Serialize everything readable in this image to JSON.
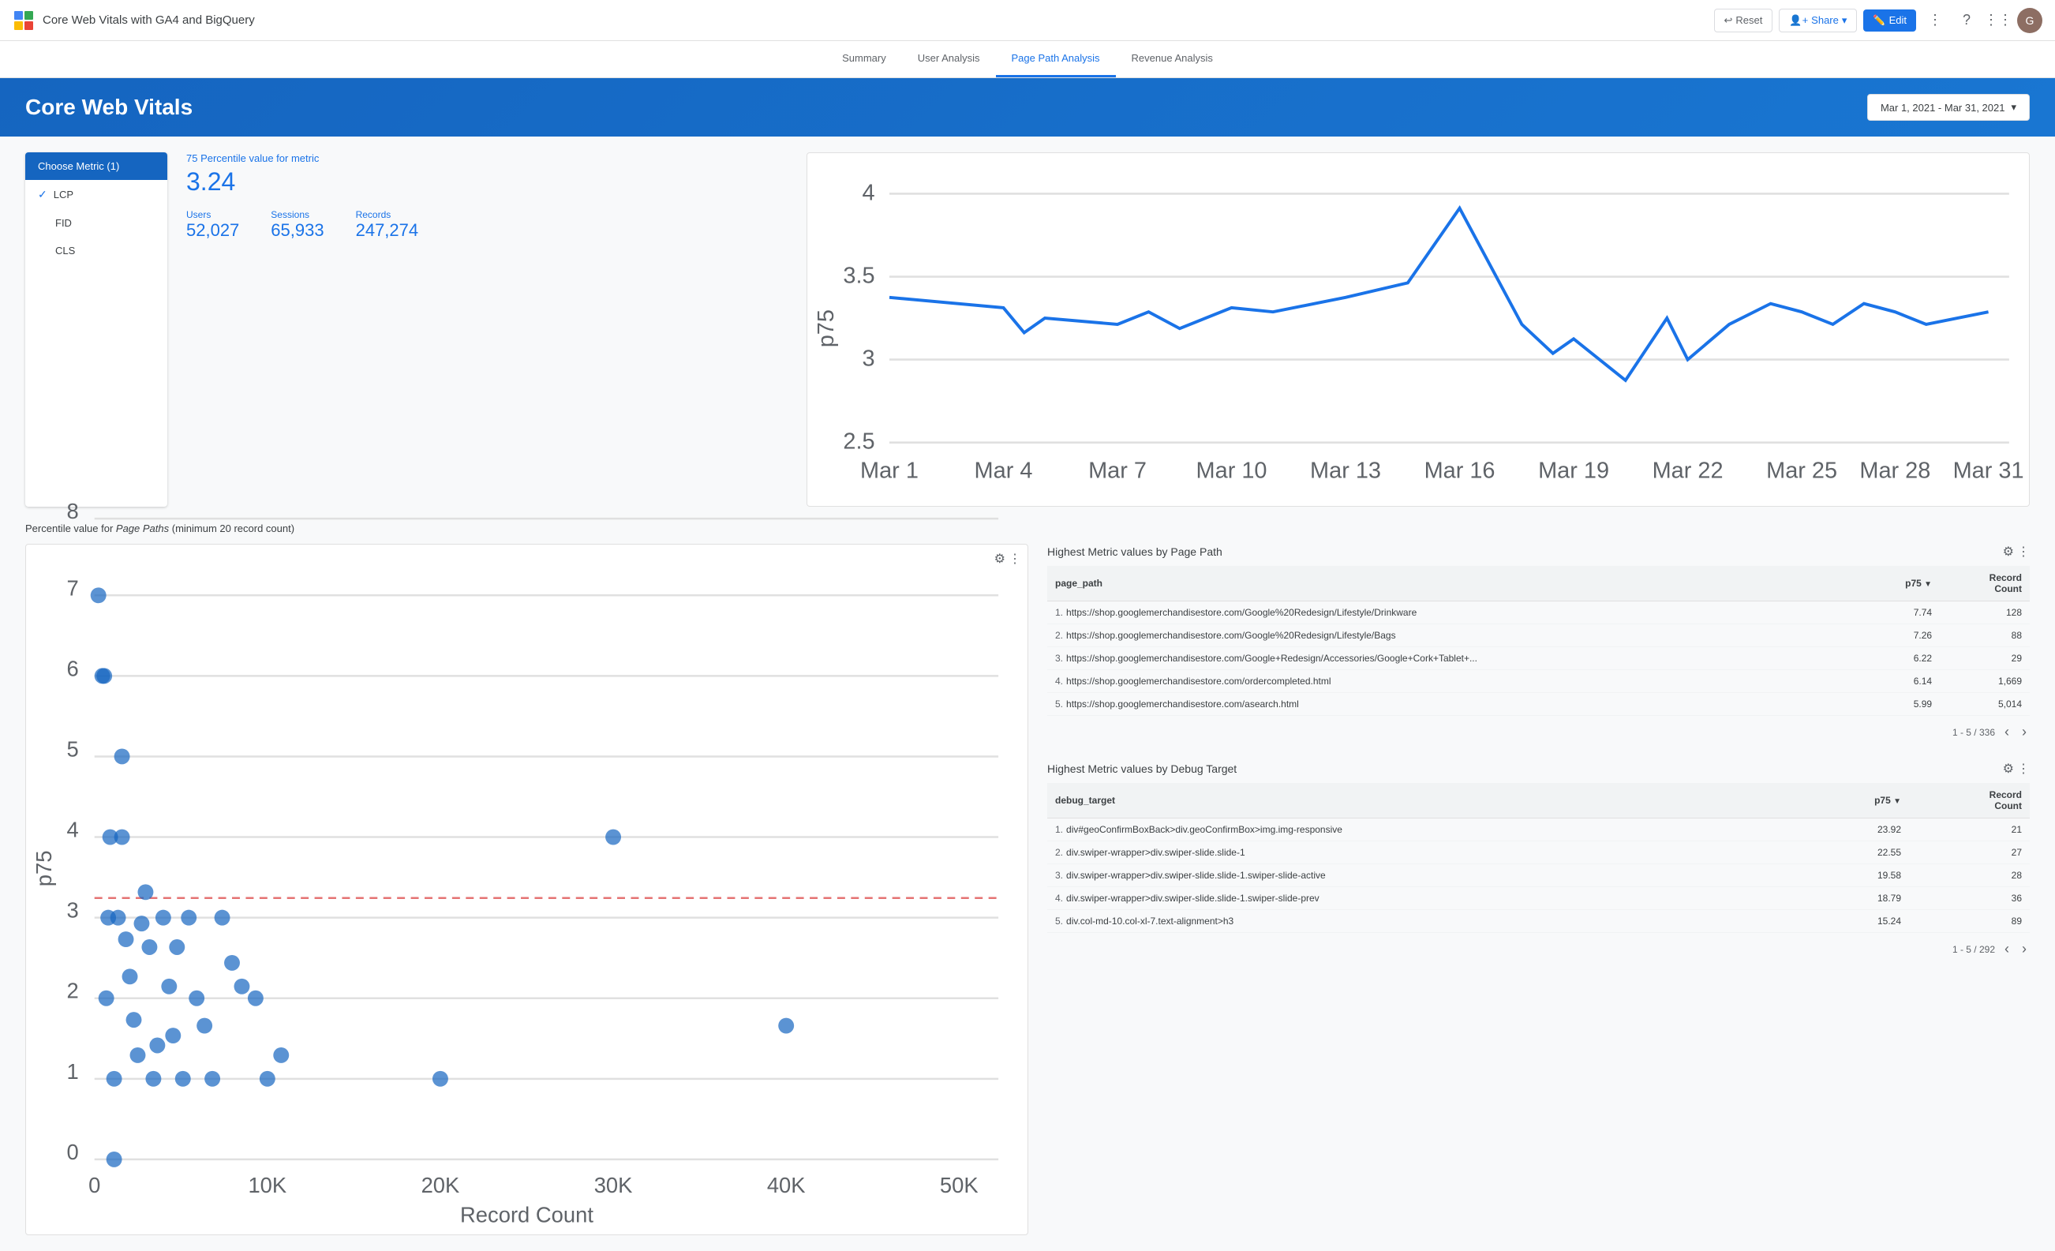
{
  "app": {
    "title": "Core Web Vitals with GA4 and BigQuery",
    "logo": "chart-icon"
  },
  "toolbar": {
    "reset_label": "Reset",
    "share_label": "Share",
    "edit_label": "Edit"
  },
  "nav": {
    "tabs": [
      {
        "label": "Summary",
        "active": false
      },
      {
        "label": "User Analysis",
        "active": false
      },
      {
        "label": "Page Path Analysis",
        "active": true
      },
      {
        "label": "Revenue Analysis",
        "active": false
      }
    ]
  },
  "banner": {
    "title": "Core Web Vitals",
    "date_range": "Mar 1, 2021 - Mar 31, 2021"
  },
  "metric_selector": {
    "header": "Choose Metric (1)",
    "options": [
      {
        "label": "LCP",
        "selected": true
      },
      {
        "label": "FID",
        "selected": false
      },
      {
        "label": "CLS",
        "selected": false
      }
    ]
  },
  "metric_stats": {
    "percentile_label": "75 Percentile value for metric",
    "percentile_value": "3.24",
    "users_label": "Users",
    "users_value": "52,027",
    "sessions_label": "Sessions",
    "sessions_value": "65,933",
    "records_label": "Records",
    "records_value": "247,274"
  },
  "line_chart": {
    "x_labels": [
      "Mar 1",
      "Mar 4",
      "Mar 7",
      "Mar 10",
      "Mar 13",
      "Mar 16",
      "Mar 19",
      "Mar 22",
      "Mar 25",
      "Mar 28",
      "Mar 31"
    ],
    "y_labels": [
      "2.5",
      "3",
      "3.5",
      "4"
    ],
    "y_axis_label": "p75"
  },
  "scatter_chart": {
    "x_axis_label": "Record Count",
    "y_axis_label": "p75",
    "x_labels": [
      "0",
      "10K",
      "20K",
      "30K",
      "40K",
      "50K"
    ],
    "y_labels": [
      "0",
      "1",
      "2",
      "3",
      "4",
      "5",
      "6",
      "7",
      "8"
    ]
  },
  "section_label": "Percentile value for Page Paths (minimum 20 record count)",
  "page_paths_table": {
    "title": "Highest Metric values by Page Path",
    "columns": [
      "page_path",
      "p75",
      "Record Count"
    ],
    "rows": [
      {
        "num": "1.",
        "path": "https://shop.googlemerchandisestore.com/Google%20Redesign/Lifestyle/Drinkware",
        "p75": "7.74",
        "count": "128"
      },
      {
        "num": "2.",
        "path": "https://shop.googlemerchandisestore.com/Google%20Redesign/Lifestyle/Bags",
        "p75": "7.26",
        "count": "88"
      },
      {
        "num": "3.",
        "path": "https://shop.googlemerchandisestore.com/Google+Redesign/Accessories/Google+Cork+Tablet+...",
        "p75": "6.22",
        "count": "29"
      },
      {
        "num": "4.",
        "path": "https://shop.googlemerchandisestore.com/ordercompleted.html",
        "p75": "6.14",
        "count": "1,669"
      },
      {
        "num": "5.",
        "path": "https://shop.googlemerchandisestore.com/asearch.html",
        "p75": "5.99",
        "count": "5,014"
      }
    ],
    "pagination": "1 - 5 / 336"
  },
  "debug_table": {
    "title": "Highest Metric values by Debug Target",
    "columns": [
      "debug_target",
      "p75",
      "Record Count"
    ],
    "rows": [
      {
        "num": "1.",
        "target": "div#geoConfirmBoxBack>div.geoConfirmBox>img.img-responsive",
        "p75": "23.92",
        "count": "21"
      },
      {
        "num": "2.",
        "target": "div.swiper-wrapper>div.swiper-slide.slide-1",
        "p75": "22.55",
        "count": "27"
      },
      {
        "num": "3.",
        "target": "div.swiper-wrapper>div.swiper-slide.slide-1.swiper-slide-active",
        "p75": "19.58",
        "count": "28"
      },
      {
        "num": "4.",
        "target": "div.swiper-wrapper>div.swiper-slide.slide-1.swiper-slide-prev",
        "p75": "18.79",
        "count": "36"
      },
      {
        "num": "5.",
        "target": "div.col-md-10.col-xl-7.text-alignment>h3",
        "p75": "15.24",
        "count": "89"
      }
    ],
    "pagination": "1 - 5 / 292"
  }
}
